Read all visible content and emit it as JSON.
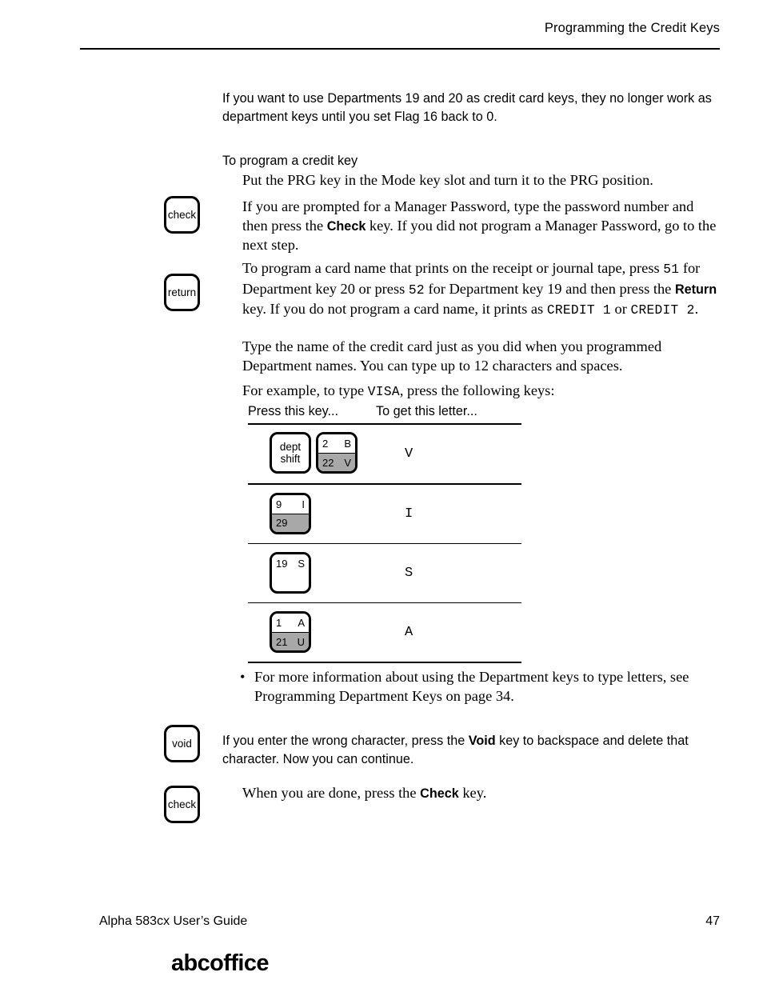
{
  "header": {
    "title": "Programming the Credit Keys"
  },
  "intro": {
    "line1": "If you want to use Departments 19 and 20 as credit card keys, they no longer",
    "line2": "work as department keys until you set Flag 16 back to 0."
  },
  "section": {
    "heading": "To program a credit key"
  },
  "steps": {
    "step1": "Put the PRG key in the Mode key slot and turn it to the PRG position.",
    "step2": {
      "part1": "If you are prompted for a Manager Password, type the password number and then press the ",
      "bold1": "Check",
      "part2": " key. If you did not program a Manager Password, go to the next step."
    },
    "step3": {
      "part1": "To program a card name that prints on the receipt or journal tape, press ",
      "mono1": "51",
      "part2": " for Department key 20 or press ",
      "mono2": "52",
      "part3": " for Department key 19 and then press the ",
      "bold1": "Return",
      "part4": " key. If you do not program a card name, it prints as ",
      "mono3": "CREDIT 1",
      "part5": " or ",
      "mono4": "CREDIT 2",
      "part6": "."
    },
    "step4": "Type the name of the credit card just as you did when you programmed Department names. You can type up to 12 characters and spaces.",
    "step5": {
      "part1": "For example, to type ",
      "mono1": "VISA",
      "part2": ", press the following keys:"
    }
  },
  "margin_keys": {
    "check1": "check",
    "return1": "return",
    "void1": "void",
    "check2": "check"
  },
  "table": {
    "col1_header": "Press this key...",
    "col2_header": "To get this letter...",
    "rows": [
      {
        "letter": "V",
        "keys": [
          {
            "style": "plain",
            "line1": "dept",
            "line2": "shift"
          },
          {
            "style": "split",
            "top_left": "2",
            "top_right": "B",
            "bottom_left": "22",
            "bottom_right": "V"
          }
        ]
      },
      {
        "letter": "I",
        "keys": [
          {
            "style": "split",
            "top_left": "9",
            "top_right": "I",
            "bottom_left": "29",
            "bottom_right": ""
          }
        ]
      },
      {
        "letter": "S",
        "keys": [
          {
            "style": "toponly",
            "top_left": "19",
            "top_right": "S",
            "bottom_left": "",
            "bottom_right": ""
          }
        ]
      },
      {
        "letter": "A",
        "keys": [
          {
            "style": "split",
            "top_left": "1",
            "top_right": "A",
            "bottom_left": "21",
            "bottom_right": "U"
          }
        ]
      }
    ]
  },
  "bullet": {
    "mark": "•",
    "text": "For more information about using the Department keys to type letters, see Programming Department Keys on page 34."
  },
  "void_note": {
    "part1": "If you enter the wrong character, press the ",
    "bold1": "Void",
    "part2": " key to backspace and delete that character. Now you can continue."
  },
  "done_note": {
    "part1": "When you are done, press the ",
    "bold1": "Check",
    "part2": " key."
  },
  "footer": {
    "left": "Alpha 583cx  User’s Guide",
    "page": "47",
    "logo": "abcoffice"
  }
}
